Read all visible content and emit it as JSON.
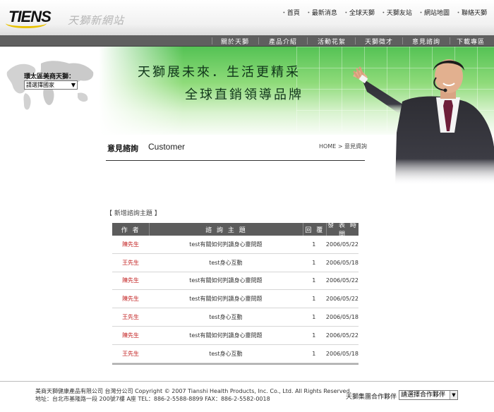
{
  "header": {
    "logo": {
      "brand": "TIENS",
      "script": "天獅新網站"
    },
    "top_links": [
      "首頁",
      "最新消息",
      "全球天獅",
      "天獅友站",
      "網站地圖",
      "聯絡天獅"
    ]
  },
  "nav": {
    "items": [
      "關於天獅",
      "產品介紹",
      "活動花絮",
      "天獅徵才",
      "意見諮詢",
      "下載專區"
    ]
  },
  "banner": {
    "region_label": "環太區美商天獅：",
    "region_select": "請選擇國家",
    "slogan_line1": "天獅展未來．生活更精采",
    "slogan_line2": "全球直銷領導品牌"
  },
  "page": {
    "title": "意見諮詢",
    "title_en": "Customer",
    "breadcrumb": "HOME > 意見資詢",
    "section_label": "【 新增諮詢主題 】"
  },
  "table": {
    "headers": [
      "作 者",
      "諮 詢 主 題",
      "回 覆",
      "發 表 時 間"
    ],
    "rows": [
      {
        "author": "陳先生",
        "subject": "test有關如何判讀身心靈問題",
        "replies": "1",
        "date": "2006/05/22"
      },
      {
        "author": "王先生",
        "subject": "test身心互動",
        "replies": "1",
        "date": "2006/05/18"
      },
      {
        "author": "陳先生",
        "subject": "test有關如何判讀身心靈問題",
        "replies": "1",
        "date": "2006/05/22"
      },
      {
        "author": "陳先生",
        "subject": "test有關如何判讀身心靈問題",
        "replies": "1",
        "date": "2006/05/22"
      },
      {
        "author": "王先生",
        "subject": "test身心互動",
        "replies": "1",
        "date": "2006/05/18"
      },
      {
        "author": "陳先生",
        "subject": "test有關如何判讀身心靈問題",
        "replies": "1",
        "date": "2006/05/22"
      },
      {
        "author": "王先生",
        "subject": "test身心互動",
        "replies": "1",
        "date": "2006/05/18"
      }
    ]
  },
  "footer": {
    "line1": "美商天獅健康產品有限公司 台灣分公司    Copyright © 2007 Tianshi Health Products, Inc. Co., Ltd. All Rights Reserved.",
    "line2": "地址：台北市基隆路一段 200號7樓 A座    TEL：886-2-5588-8899    FAX：886-2-5582-0018",
    "partner_label": "天獅集團合作夥伴",
    "partner_select": "請選擇合作夥伴"
  },
  "colors": {
    "nav_bg": "#5f5f5f",
    "banner_green": "#54c254",
    "author_red": "#c32222"
  }
}
